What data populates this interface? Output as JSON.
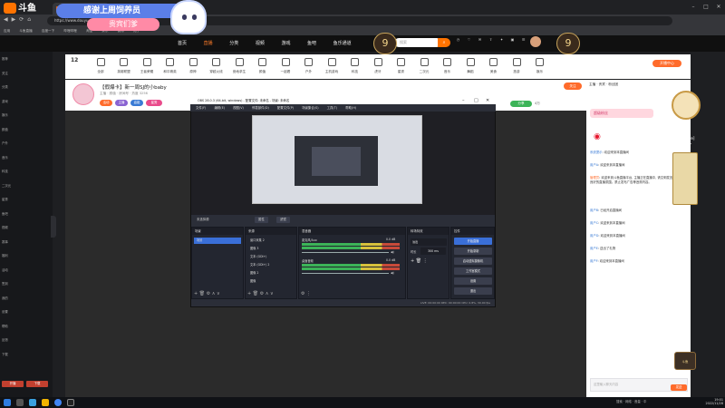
{
  "browser": {
    "tab_title": "斗鱼直播",
    "address": "https://www.douyu.com/",
    "bookmarks": [
      "应用",
      "斗鱼直播",
      "百度一下",
      "哔哩哔哩",
      "淘宝",
      "京东",
      "微博",
      "知乎"
    ]
  },
  "overlay": {
    "banner_text": "感谢上周饲养员",
    "banner_sub": "贵宾们爹",
    "deco_badge": "9"
  },
  "header": {
    "logo": "斗鱼",
    "nav": [
      "首页",
      "直播",
      "分类",
      "视频",
      "游戏",
      "鱼吧",
      "鱼乐通道"
    ],
    "active_nav": "直播",
    "search_placeholder": "搜索"
  },
  "categories": {
    "count": "12",
    "items": [
      "全部",
      "英雄联盟",
      "王者荣耀",
      "和平精英",
      "原神",
      "穿越火线",
      "绝地求生",
      "颜值",
      "一起看",
      "户外",
      "主机游戏",
      "科技",
      "虎牙",
      "星秀",
      "二次元",
      "音乐",
      "舞蹈",
      "美食",
      "旅游",
      "娱乐"
    ],
    "open_button": "开播中心"
  },
  "room": {
    "title": "【假爆卡】新一周SJ的小baby",
    "meta": "主播 · 颜值 · 房间号 · 热度 3256",
    "tags": [
      "活动",
      "主播",
      "高能",
      "星秀"
    ],
    "follow_button": "关注",
    "share": "分享",
    "count": "4万"
  },
  "obs": {
    "title": "OBS 28.0.3 (64-bit, windows) - 配置文件: 未命名 - 场景: 未命名",
    "menu": [
      "文件(F)",
      "编辑(E)",
      "视图(V)",
      "停靠部件(D)",
      "配置文件(P)",
      "场景集合(S)",
      "工具(T)",
      "帮助(H)"
    ],
    "status_label": "未选择源",
    "status_btn1": "属性",
    "status_btn2": "滤镜",
    "scenes": {
      "header": "场景",
      "items": [
        "场景"
      ]
    },
    "sources": {
      "header": "来源",
      "items": [
        "窗口采集 2",
        "图像 3",
        "文本 (GDI+)",
        "文本 (GDI+) 2",
        "图像 2",
        "图像"
      ]
    },
    "mixer": {
      "header": "混音器",
      "tracks": [
        {
          "name": "麦克风/Aux",
          "db": "0.0 dB"
        },
        {
          "name": "桌面音频",
          "db": "0.0 dB"
        }
      ]
    },
    "transitions": {
      "header": "转场特效",
      "type": "淡出",
      "duration_label": "时长",
      "duration": "300 ms"
    },
    "controls": {
      "header": "控件",
      "buttons": [
        "开始直播",
        "开始录制",
        "启动虚拟摄像机",
        "工作室模式",
        "设置",
        "退出"
      ]
    },
    "bottom": "LIVE: 00:00:00   REC: 00:00:00   CPU: 0.8%, 30.00 fps"
  },
  "chat": {
    "header": "主播 · 贵宾 · 粉丝团",
    "gift_label": "超级粉丝",
    "messages": [
      {
        "user": "系统提示",
        "text": "欢迎来到本直播间"
      },
      {
        "user": "用户A",
        "text": "欢迎来到本直播间"
      },
      {
        "user": "管理员",
        "text": "欢迎来到斗鱼直播平台, 主播正在直播中, 请文明发言, 共同维护良好的直播氛围。禁止发布广告等违规内容。"
      },
      {
        "user": "用户B",
        "text": "已经开启直播间"
      },
      {
        "user": "用户C",
        "text": "欢迎来到本直播间"
      },
      {
        "user": "用户D",
        "text": "欢迎来到本直播间"
      },
      {
        "user": "用户E",
        "text": "送出了礼物"
      },
      {
        "user": "用户F",
        "text": "欢迎来到本直播间"
      }
    ],
    "input_placeholder": "这里输入聊天内容",
    "send_label": "发送"
  },
  "deco_right": {
    "title": "华彩",
    "line": "金ye]",
    "line2": "记~",
    "badge": "斗鱼"
  },
  "sidebar": {
    "rows": [
      "推荐",
      "关注",
      "分类",
      "游戏",
      "娱乐",
      "颜值",
      "户外",
      "音乐",
      "科技",
      "二次元",
      "星秀",
      "鱼吧",
      "视频",
      "赛事",
      "福利",
      "活动",
      "签到",
      "我的",
      "设置",
      "帮助",
      "反馈",
      "下载"
    ],
    "btn1": "开播",
    "btn2": "下载"
  },
  "taskbar": {
    "tray": "搜索 · 网络 · 音量 · 中",
    "time": "19:01",
    "date": "2022/11/28"
  },
  "colors": {
    "accent": "#ff6b2b",
    "obs_bg": "#2b2e38",
    "meter_green": "#3cb458"
  }
}
